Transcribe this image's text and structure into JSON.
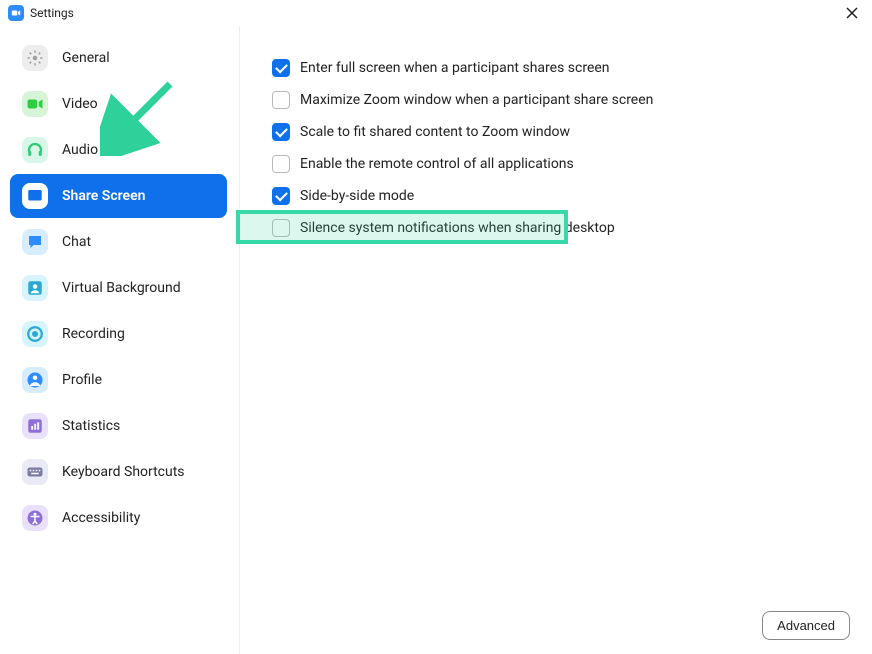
{
  "window": {
    "title": "Settings"
  },
  "sidebar": {
    "items": [
      {
        "label": "General",
        "icon": "gear",
        "bg": "#ededed",
        "fg": "#9e9e9e"
      },
      {
        "label": "Video",
        "icon": "video",
        "bg": "#d6f5d6",
        "fg": "#2ecc40"
      },
      {
        "label": "Audio",
        "icon": "headphones",
        "bg": "#d8f6e9",
        "fg": "#2ecc71"
      },
      {
        "label": "Share Screen",
        "icon": "share",
        "bg": "#ffffff",
        "fg": "#0e71eb",
        "active": true
      },
      {
        "label": "Chat",
        "icon": "chat",
        "bg": "#d6ecff",
        "fg": "#2d8cff"
      },
      {
        "label": "Virtual Background",
        "icon": "virtualbg",
        "bg": "#d6f4fb",
        "fg": "#2aa9d2"
      },
      {
        "label": "Recording",
        "icon": "record",
        "bg": "#d6f4fb",
        "fg": "#2aa9d2"
      },
      {
        "label": "Profile",
        "icon": "profile",
        "bg": "#d6ecff",
        "fg": "#2d8cff"
      },
      {
        "label": "Statistics",
        "icon": "stats",
        "bg": "#e9e1fb",
        "fg": "#8e6fd8"
      },
      {
        "label": "Keyboard Shortcuts",
        "icon": "keyboard",
        "bg": "#eaeaf7",
        "fg": "#7b7ba6"
      },
      {
        "label": "Accessibility",
        "icon": "accessibility",
        "bg": "#e9e1fb",
        "fg": "#8e6fd8"
      }
    ]
  },
  "options": [
    {
      "label": "Enter full screen when a participant shares screen",
      "checked": true
    },
    {
      "label": "Maximize Zoom window when a participant share screen",
      "checked": false
    },
    {
      "label": "Scale to fit shared content to Zoom window",
      "checked": true
    },
    {
      "label": "Enable the remote control of all applications",
      "checked": false
    },
    {
      "label": "Side-by-side mode",
      "checked": true
    },
    {
      "label": "Silence system notifications when sharing desktop",
      "checked": false
    }
  ],
  "footer": {
    "advanced_label": "Advanced"
  },
  "annotations": {
    "highlight_color": "#38d9a9",
    "arrow_color": "#2ed19a"
  }
}
